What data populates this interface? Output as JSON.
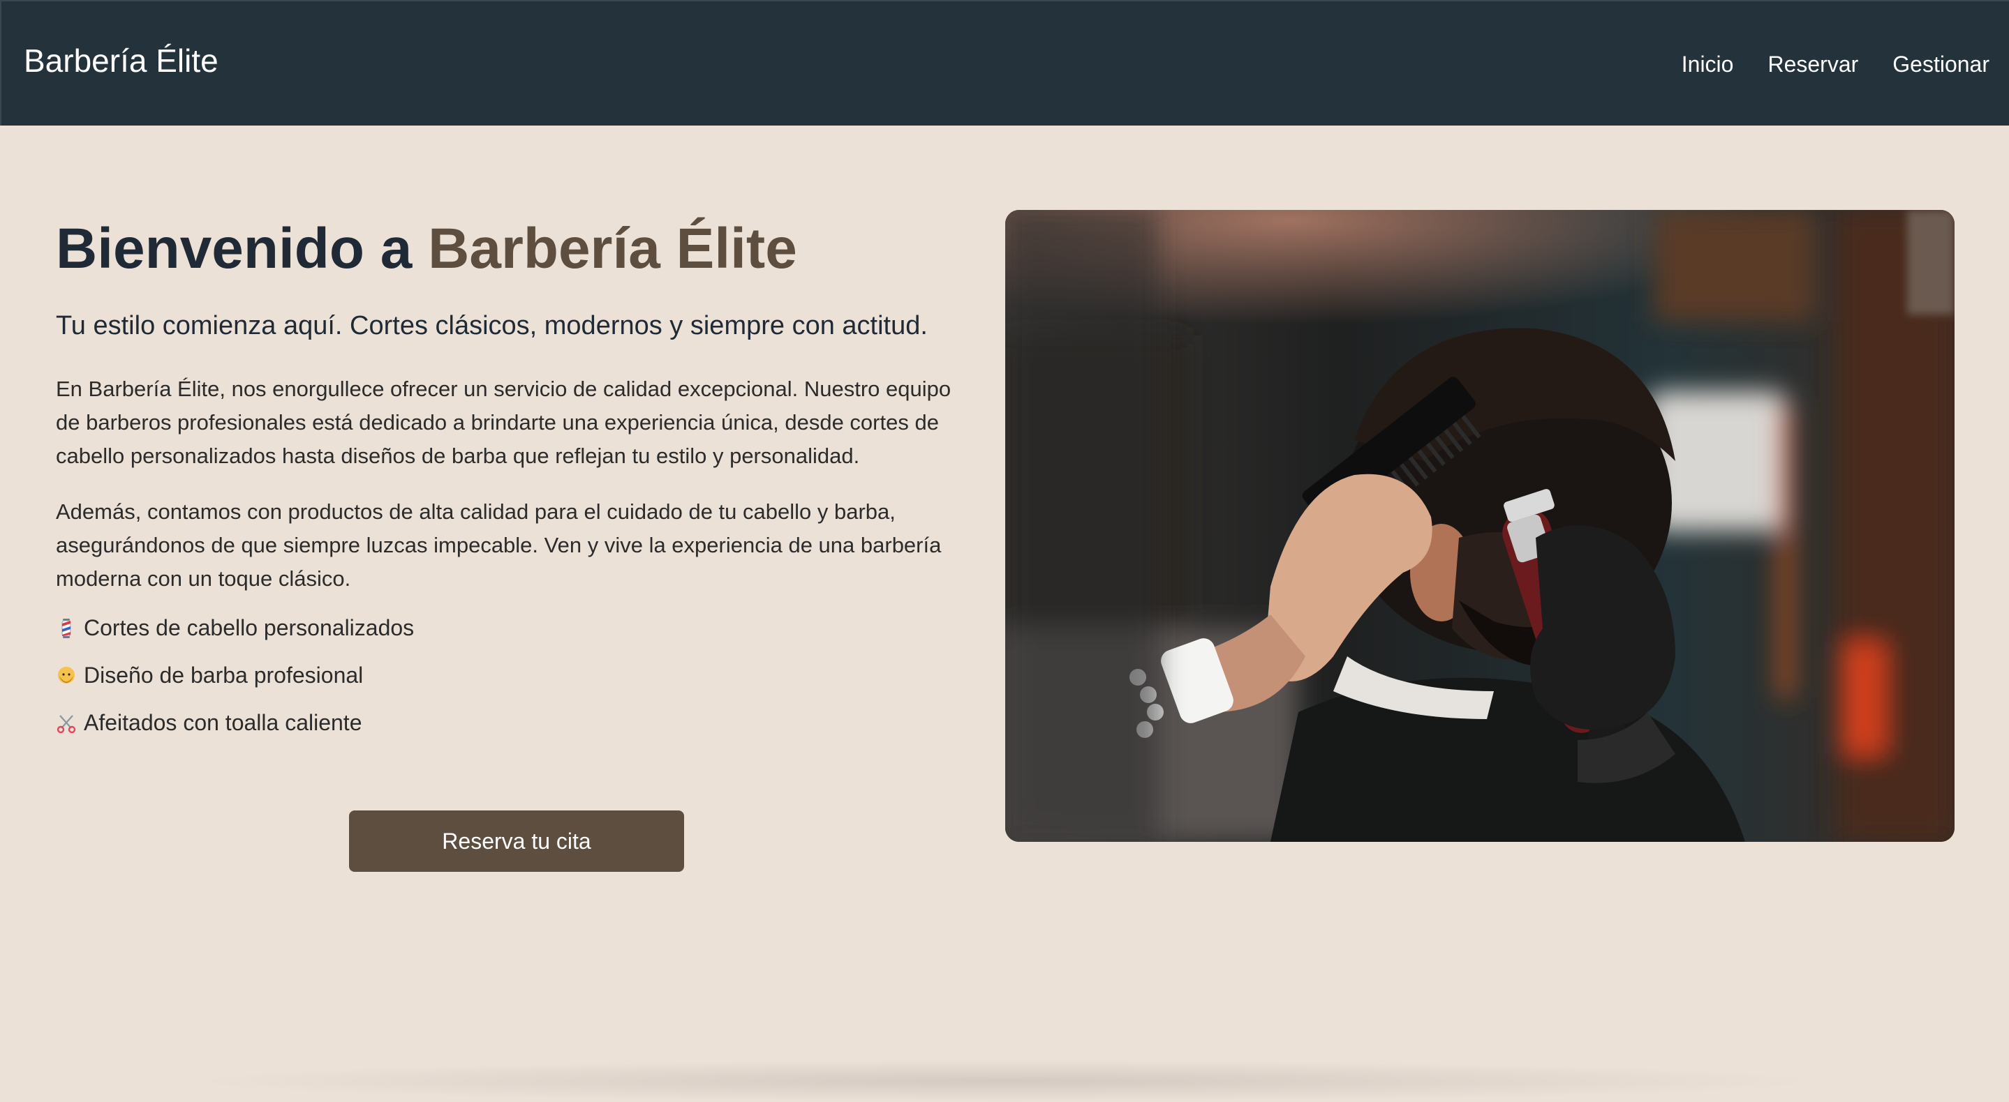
{
  "navbar": {
    "brand": "Barbería Élite",
    "links": [
      {
        "label": "Inicio"
      },
      {
        "label": "Reservar"
      },
      {
        "label": "Gestionar"
      }
    ]
  },
  "hero": {
    "title_prefix": "Bienvenido a ",
    "title_accent": "Barbería Élite",
    "lead": "Tu estilo comienza aquí. Cortes clásicos, modernos y siempre con actitud.",
    "paragraphs": [
      "En Barbería Élite, nos enorgullece ofrecer un servicio de calidad excepcional. Nuestro equipo de barberos profesionales está dedicado a brindarte una experiencia única, desde cortes de cabello personalizados hasta diseños de barba que reflejan tu estilo y personalidad.",
      "Además, contamos con productos de alta calidad para el cuidado de tu cabello y barba, asegurándonos de que siempre luzcas impecable. Ven y vive la experiencia de una barbería moderna con un toque clásico."
    ],
    "features": [
      {
        "icon": "barber-pole-icon",
        "label": "Cortes de cabello personalizados"
      },
      {
        "icon": "bearded-face-icon",
        "label": "Diseño de barba profesional"
      },
      {
        "icon": "scissors-icon",
        "label": "Afeitados con toalla caliente"
      }
    ],
    "cta_label": "Reserva tu cita",
    "image": "barber-cutting-hair-photo"
  },
  "colors": {
    "navbar_bg": "#24323c",
    "page_bg": "#ece1d7",
    "accent_brown": "#5d4e3f",
    "heading_dark": "#1f2a36"
  }
}
